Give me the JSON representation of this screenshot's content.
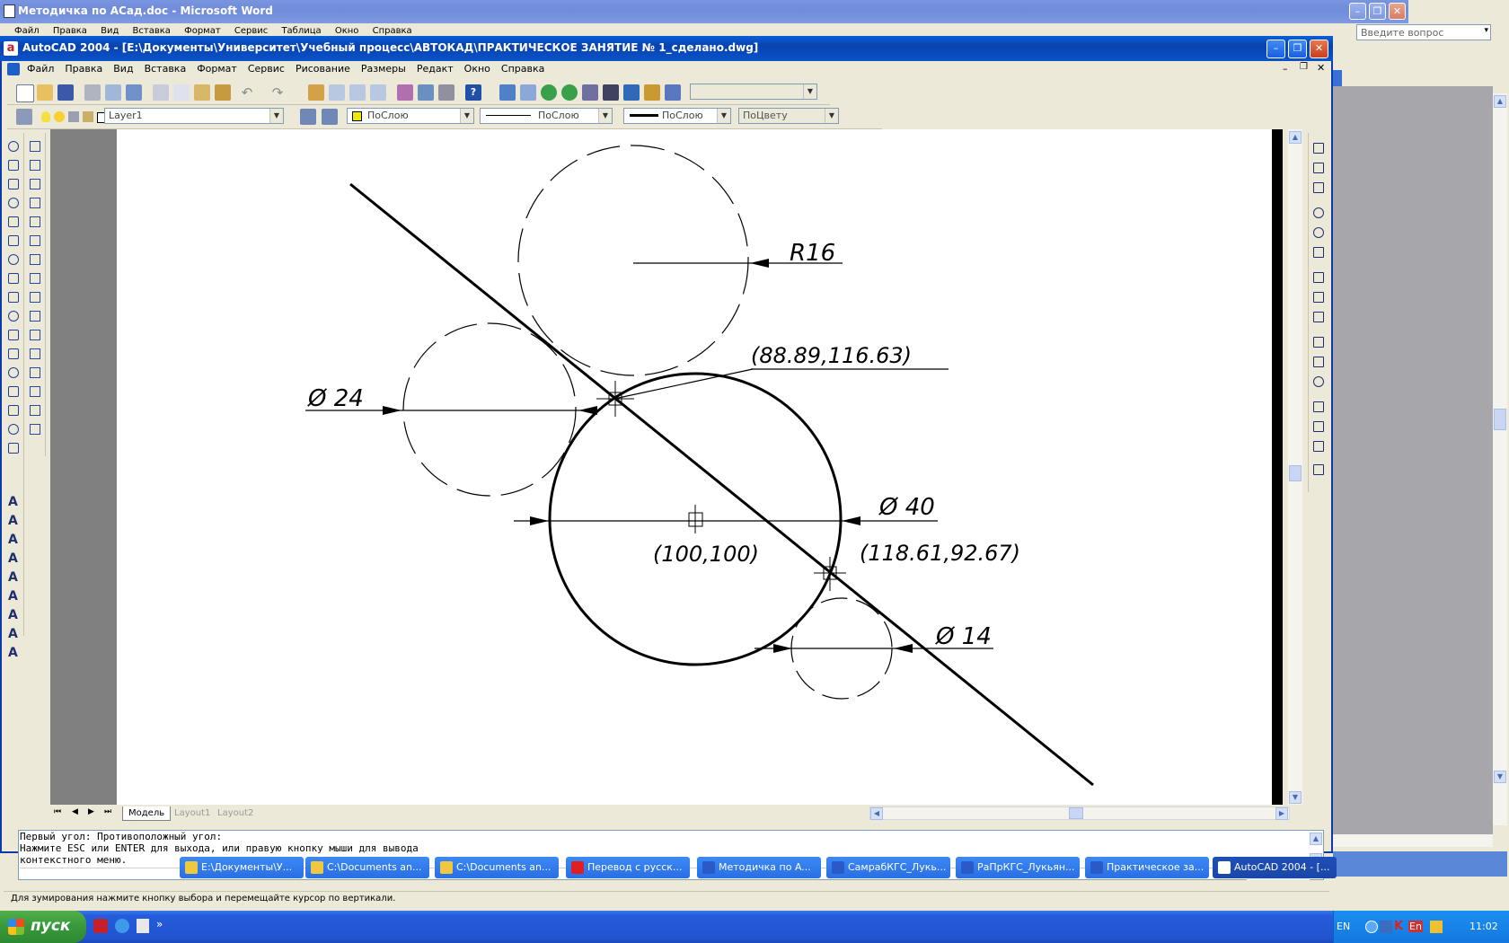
{
  "word": {
    "title": "Методичка по ACад.doc - Microsoft Word",
    "menu": [
      "Файл",
      "Правка",
      "Вид",
      "Вставка",
      "Формат",
      "Сервис",
      "Таблица",
      "Окно",
      "Справка"
    ],
    "help_placeholder": "Введите вопрос"
  },
  "autocad": {
    "title": "AutoCAD 2004 - [E:\\Документы\\Университет\\Учебный процесс\\АВТОКАД\\ПРАКТИЧЕСКОЕ ЗАНЯТИЕ № 1_сделано.dwg]",
    "menu": [
      "Файл",
      "Правка",
      "Вид",
      "Вставка",
      "Формат",
      "Сервис",
      "Рисование",
      "Размеры",
      "Редакт",
      "Окно",
      "Справка"
    ],
    "layer": "Layer1",
    "color": "ПоСлою",
    "linetype": "ПоСлою",
    "lineweight": "ПоСлою",
    "plotstyle": "ПоЦвету",
    "tabs": [
      "Модель",
      "Layout1",
      "Layout2"
    ],
    "command_lines": [
      "Первый угол: Противоположный угол:",
      "Нажмите ESC или ENTER для выхода, или правую кнопку мыши для вывода",
      "контекстного меню."
    ],
    "status": "Для зумирования нажмите кнопку выбора и перемещайте курсор по вертикали."
  },
  "drawing": {
    "r16": "R16",
    "d24": "Ø 24",
    "d40": "Ø 40",
    "d14": "Ø 14",
    "pt_upper": "(88.89,116.63)",
    "pt_center": "(100,100)",
    "pt_lower": "(118.61,92.67)"
  },
  "taskbar": {
    "start": "пуск",
    "items": [
      "E:\\Документы\\У...",
      "C:\\Documents an...",
      "C:\\Documents an...",
      "Перевод с русск...",
      "Методичка по A...",
      "СамрабКГС_Лукь...",
      "РаПрКГС_Лукьян...",
      "Практическое за...",
      "AutoCAD 2004 - [..."
    ],
    "lang": "EN",
    "tray_lang": "En",
    "clock": "11:02"
  }
}
